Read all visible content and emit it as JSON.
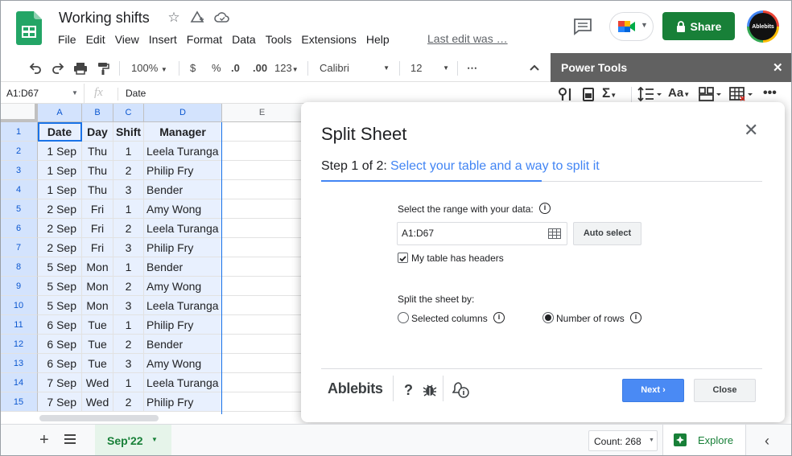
{
  "app": {
    "doc_title": "Working shifts",
    "menu": [
      "File",
      "Edit",
      "View",
      "Insert",
      "Format",
      "Data",
      "Tools",
      "Extensions",
      "Help"
    ],
    "last_edit": "Last edit was …",
    "share_label": "Share",
    "avatar_text": "Ablebits",
    "colors": {
      "green": "#188038",
      "blue": "#4285f4",
      "sidebar": "#616161",
      "selection": "#e8f0fe"
    }
  },
  "toolbar": {
    "zoom": "100%",
    "currency": "$",
    "percent": "%",
    "dec_decrease": ".0",
    "dec_increase": ".00",
    "format_more": "123",
    "font": "Calibri",
    "size": "12",
    "more": "⋯"
  },
  "formula_bar": {
    "name_box": "A1:D67",
    "fx": "fx",
    "content": "Date"
  },
  "grid": {
    "columns": [
      "A",
      "B",
      "C",
      "D",
      "E"
    ],
    "rows": [
      [
        "Date",
        "Day",
        "Shift",
        "Manager"
      ],
      [
        "1 Sep",
        "Thu",
        "1",
        "Leela Turanga"
      ],
      [
        "1 Sep",
        "Thu",
        "2",
        "Philip Fry"
      ],
      [
        "1 Sep",
        "Thu",
        "3",
        "Bender"
      ],
      [
        "2 Sep",
        "Fri",
        "1",
        "Amy Wong"
      ],
      [
        "2 Sep",
        "Fri",
        "2",
        "Leela Turanga"
      ],
      [
        "2 Sep",
        "Fri",
        "3",
        "Philip Fry"
      ],
      [
        "5 Sep",
        "Mon",
        "1",
        "Bender"
      ],
      [
        "5 Sep",
        "Mon",
        "2",
        "Amy Wong"
      ],
      [
        "5 Sep",
        "Mon",
        "3",
        "Leela Turanga"
      ],
      [
        "6 Sep",
        "Tue",
        "1",
        "Philip Fry"
      ],
      [
        "6 Sep",
        "Tue",
        "2",
        "Bender"
      ],
      [
        "6 Sep",
        "Tue",
        "3",
        "Amy Wong"
      ],
      [
        "7 Sep",
        "Wed",
        "1",
        "Leela Turanga"
      ],
      [
        "7 Sep",
        "Wed",
        "2",
        "Philip Fry"
      ]
    ],
    "row_numbers": [
      "1",
      "2",
      "3",
      "4",
      "5",
      "6",
      "7",
      "8",
      "9",
      "10",
      "11",
      "12",
      "13",
      "14",
      "15"
    ]
  },
  "sidebar": {
    "title": "Power Tools",
    "close": "✕",
    "tool_icons": [
      "filter-icon",
      "trash-icon",
      "sum-icon",
      "line-spacing-icon",
      "text-case-icon",
      "split-cells-icon",
      "table-delete-icon",
      "more-icon"
    ]
  },
  "dialog": {
    "title": "Split Sheet",
    "close": "✕",
    "step_prefix": "Step 1 of 2:",
    "step_text": "Select your table and a way to split it",
    "range_label": "Select the range with your data:",
    "range_value": "A1:D67",
    "auto_select": "Auto select",
    "headers_label": "My table has headers",
    "headers_checked": true,
    "split_by_label": "Split the sheet by:",
    "option_columns": "Selected columns",
    "option_rows": "Number of rows",
    "selected_option": "rows",
    "brand": "Ablebits",
    "help": "?",
    "next": "Next",
    "close_btn": "Close"
  },
  "bottom": {
    "sheet_tab": "Sep'22",
    "count": "Count: 268",
    "explore": "Explore"
  }
}
